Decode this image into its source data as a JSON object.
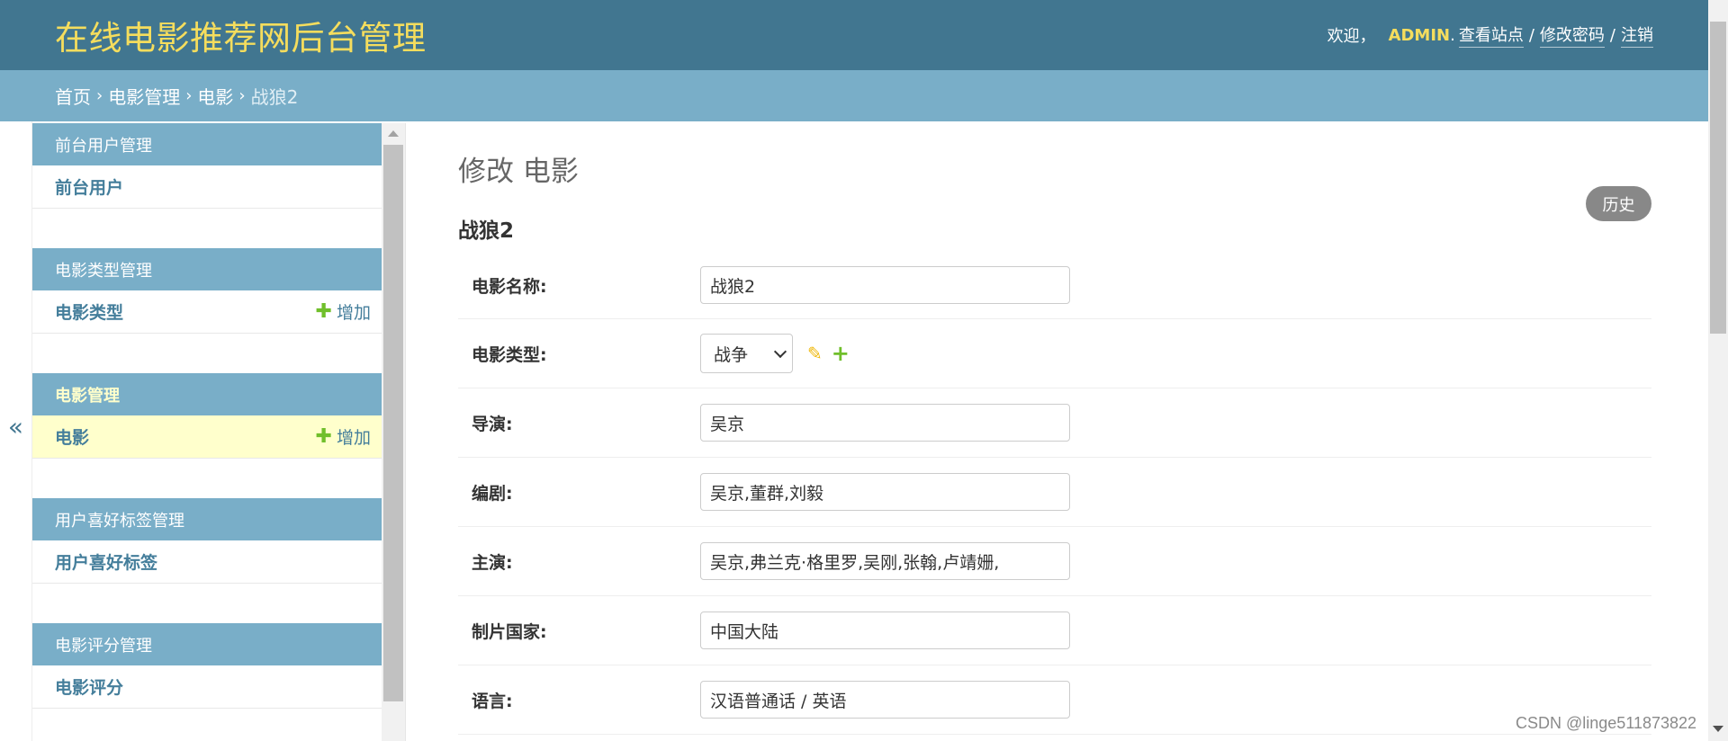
{
  "header": {
    "brand": "在线电影推荐网后台管理",
    "welcome": "欢迎，",
    "username": "ADMIN",
    "dot": ".",
    "view_site": "查看站点",
    "change_password": "修改密码",
    "logout": "注销",
    "separator": "/"
  },
  "breadcrumbs": {
    "home": "首页",
    "app": "电影管理",
    "model": "电影",
    "current": "战狼2",
    "arrow": "›"
  },
  "nav_toggle": "«",
  "sidebar": {
    "modules": [
      {
        "caption": "前台用户管理",
        "model": "前台用户",
        "add": ""
      },
      {
        "caption": "电影类型管理",
        "model": "电影类型",
        "add": "增加"
      },
      {
        "caption": "电影管理",
        "model": "电影",
        "add": "增加"
      },
      {
        "caption": "用户喜好标签管理",
        "model": "用户喜好标签",
        "add": ""
      },
      {
        "caption": "电影评分管理",
        "model": "电影评分",
        "add": ""
      }
    ]
  },
  "content": {
    "page_title": "修改 电影",
    "history": "历史",
    "object_title": "战狼2",
    "fields": [
      {
        "label": "电影名称:",
        "value": "战狼2"
      },
      {
        "label": "电影类型:",
        "value": "战争"
      },
      {
        "label": "导演:",
        "value": "吴京"
      },
      {
        "label": "编剧:",
        "value": "吴京,董群,刘毅"
      },
      {
        "label": "主演:",
        "value": "吴京,弗兰克·格里罗,吴刚,张翰,卢靖姗,"
      },
      {
        "label": "制片国家:",
        "value": "中国大陆"
      },
      {
        "label": "语言:",
        "value": "汉语普通话 / 英语"
      }
    ]
  },
  "watermark": "CSDN @linge511873822",
  "colors": {
    "header_bg": "#417690",
    "breadcrumb_bg": "#79aec8",
    "brand": "#f5dd5d",
    "link": "#447e9b",
    "add_green": "#70bf2b",
    "current_row": "#ffffcc"
  }
}
